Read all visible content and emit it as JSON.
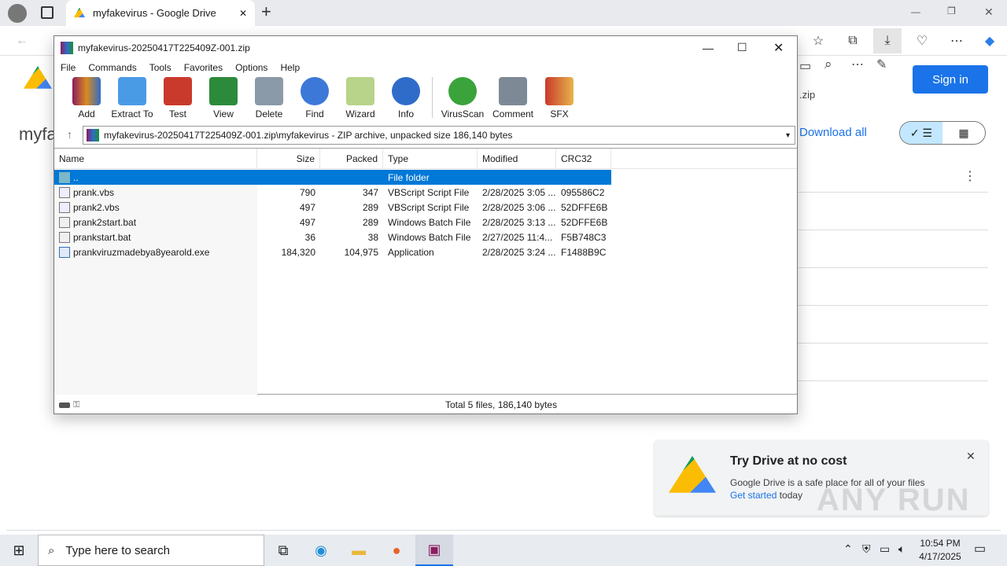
{
  "browser": {
    "tab_title": "myfakevirus - Google Drive",
    "new_tab": "+",
    "minimize": "—",
    "restore": "❐",
    "close": "✕"
  },
  "drive": {
    "page_title_partial": "myfa",
    "sign_in": "Sign in",
    "zip_suffix": ".zip",
    "download_all": "Download all"
  },
  "winrar": {
    "title": "myfakevirus-20250417T225409Z-001.zip",
    "menu": [
      "File",
      "Commands",
      "Tools",
      "Favorites",
      "Options",
      "Help"
    ],
    "tools": [
      "Add",
      "Extract To",
      "Test",
      "View",
      "Delete",
      "Find",
      "Wizard",
      "Info",
      "VirusScan",
      "Comment",
      "SFX"
    ],
    "address": "myfakevirus-20250417T225409Z-001.zip\\myfakevirus - ZIP archive, unpacked size 186,140 bytes",
    "columns": [
      "Name",
      "Size",
      "Packed",
      "Type",
      "Modified",
      "CRC32"
    ],
    "rows": [
      [
        "..",
        "",
        "",
        "File folder",
        "",
        ""
      ],
      [
        "prank.vbs",
        "790",
        "347",
        "VBScript Script File",
        "2/28/2025 3:05 ...",
        "095586C2"
      ],
      [
        "prank2.vbs",
        "497",
        "289",
        "VBScript Script File",
        "2/28/2025 3:06 ...",
        "52DFFE6B"
      ],
      [
        "prank2start.bat",
        "497",
        "289",
        "Windows Batch File",
        "2/28/2025 3:13 ...",
        "52DFFE6B"
      ],
      [
        "prankstart.bat",
        "36",
        "38",
        "Windows Batch File",
        "2/27/2025 11:4...",
        "F5B748C3"
      ],
      [
        "prankviruzmadebya8yearold.exe",
        "184,320",
        "104,975",
        "Application",
        "2/28/2025 3:24 ...",
        "F1488B9C"
      ]
    ],
    "status": "Total 5 files, 186,140 bytes"
  },
  "popup": {
    "title": "Try Drive at no cost",
    "body": "Google Drive is a safe place for all of your files",
    "link": "Get started",
    "tail": "today",
    "close": "✕"
  },
  "watermark": "ANY RUN",
  "taskbar": {
    "search_placeholder": "Type here to search",
    "time": "10:54 PM",
    "date": "4/17/2025"
  }
}
